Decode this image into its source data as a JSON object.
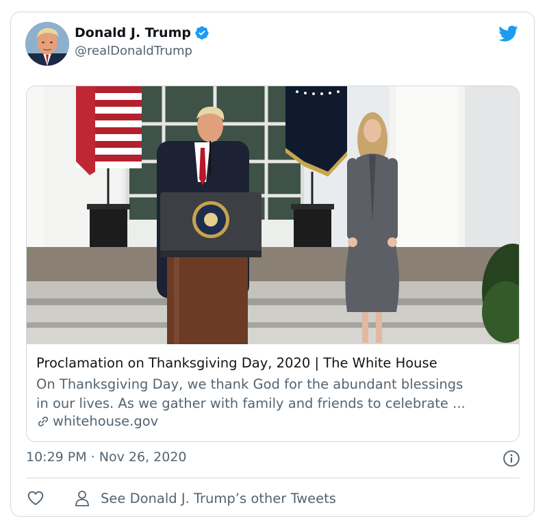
{
  "tweet": {
    "author_name": "Donald J. Trump",
    "author_handle": "@realDonaldTrump",
    "timestamp": "10:29 PM · Nov 26, 2020",
    "other_tweets_label": "See Donald J. Trump’s other Tweets"
  },
  "link_card": {
    "title": "Proclamation on Thanksgiving Day, 2020 | The White House",
    "description_line1": "On Thanksgiving Day, we thank God for the abundant blessings",
    "description_line2": "in our lives.  As we gather with family and friends to celebrate ...",
    "domain": "whitehouse.gov"
  },
  "icons": {
    "verified": "verified-badge-icon",
    "brand": "twitter-bird-icon",
    "info": "info-icon",
    "like": "heart-icon",
    "profile": "person-icon",
    "link": "link-icon"
  },
  "colors": {
    "brand_blue": "#1d9bf0",
    "text_primary": "#0f1419",
    "text_secondary": "#536471",
    "border": "#cfd9de"
  }
}
